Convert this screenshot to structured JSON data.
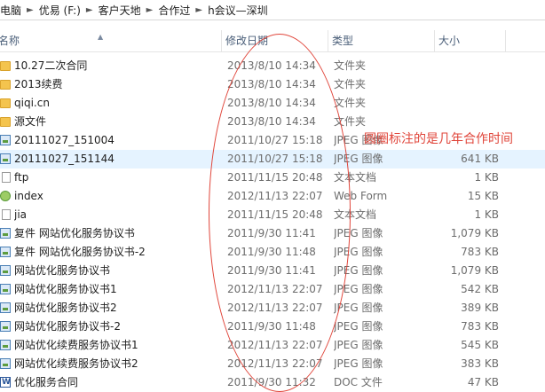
{
  "breadcrumb": [
    "电脑",
    "优易 (F:)",
    "客户天地",
    "合作过",
    "h会议—深圳"
  ],
  "columns": {
    "name": "名称",
    "date": "修改日期",
    "type": "类型",
    "size": "大小"
  },
  "annotation": "圆圈标注的是几年合作时间",
  "annotation_color": "#e0453a",
  "files": [
    {
      "icon": "folder-icon",
      "name": "10.27二次合同",
      "date": "2013/8/10 14:34",
      "type": "文件夹",
      "size": ""
    },
    {
      "icon": "folder-icon",
      "name": "2013续费",
      "date": "2013/8/10 14:34",
      "type": "文件夹",
      "size": ""
    },
    {
      "icon": "folder-icon",
      "name": "qiqi.cn",
      "date": "2013/8/10 14:34",
      "type": "文件夹",
      "size": ""
    },
    {
      "icon": "folder-icon",
      "name": "源文件",
      "date": "2013/8/10 14:34",
      "type": "文件夹",
      "size": ""
    },
    {
      "icon": "image-icon",
      "name": "20111027_151004",
      "date": "2011/10/27 15:18",
      "type": "JPEG 图像",
      "size": ""
    },
    {
      "icon": "image-icon",
      "name": "20111027_151144",
      "date": "2011/10/27 15:18",
      "type": "JPEG 图像",
      "size": "641 KB"
    },
    {
      "icon": "text-file-icon",
      "name": "ftp",
      "date": "2011/11/15 20:48",
      "type": "文本文档",
      "size": "1 KB"
    },
    {
      "icon": "web-form-icon",
      "name": "index",
      "date": "2012/11/13 22:07",
      "type": "Web Form",
      "size": "15 KB"
    },
    {
      "icon": "text-file-icon",
      "name": "jia",
      "date": "2011/11/15 20:48",
      "type": "文本文档",
      "size": "1 KB"
    },
    {
      "icon": "image-icon",
      "name": "复件 网站优化服务协议书",
      "date": "2011/9/30 11:41",
      "type": "JPEG 图像",
      "size": "1,079 KB"
    },
    {
      "icon": "image-icon",
      "name": "复件 网站优化服务协议书-2",
      "date": "2011/9/30 11:48",
      "type": "JPEG 图像",
      "size": "783 KB"
    },
    {
      "icon": "image-icon",
      "name": "网站优化服务协议书",
      "date": "2011/9/30 11:41",
      "type": "JPEG 图像",
      "size": "1,079 KB"
    },
    {
      "icon": "image-icon",
      "name": "网站优化服务协议书1",
      "date": "2012/11/13 22:07",
      "type": "JPEG 图像",
      "size": "542 KB"
    },
    {
      "icon": "image-icon",
      "name": "网站优化服务协议书2",
      "date": "2012/11/13 22:07",
      "type": "JPEG 图像",
      "size": "389 KB"
    },
    {
      "icon": "image-icon",
      "name": "网站优化服务协议书-2",
      "date": "2011/9/30 11:48",
      "type": "JPEG 图像",
      "size": "783 KB"
    },
    {
      "icon": "image-icon",
      "name": "网站优化续费服务协议书1",
      "date": "2012/11/13 22:07",
      "type": "JPEG 图像",
      "size": "545 KB"
    },
    {
      "icon": "image-icon",
      "name": "网站优化续费服务协议书2",
      "date": "2012/11/13 22:07",
      "type": "JPEG 图像",
      "size": "383 KB"
    },
    {
      "icon": "word-doc-icon",
      "name": "优化服务合同",
      "date": "2011/9/30 11:32",
      "type": "DOC 文件",
      "size": "47 KB"
    }
  ]
}
